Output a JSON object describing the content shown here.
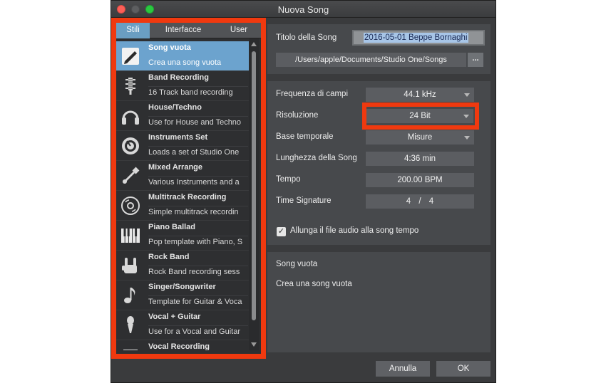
{
  "window": {
    "title": "Nuova Song"
  },
  "tabs": [
    {
      "label": "Stili",
      "active": true
    },
    {
      "label": "Interfacce",
      "active": false
    },
    {
      "label": "User",
      "active": false
    }
  ],
  "styles": [
    {
      "name": "Song vuota",
      "desc": "Crea una song vuota",
      "icon": "blank-document-icon",
      "selected": true
    },
    {
      "name": "Band Recording",
      "desc": "16 Track band recording",
      "icon": "microphone-grille-icon"
    },
    {
      "name": "House/Techno",
      "desc": "Use for House and Techno",
      "icon": "headphones-icon"
    },
    {
      "name": "Instruments Set",
      "desc": "Loads a set of  Studio One",
      "icon": "knob-icon"
    },
    {
      "name": "Mixed Arrange",
      "desc": "Various Instruments and a",
      "icon": "guitar-neck-icon"
    },
    {
      "name": "Multitrack Recording",
      "desc": "Simple multitrack recordin",
      "icon": "disc-icon"
    },
    {
      "name": "Piano Ballad",
      "desc": "Pop template with Piano, S",
      "icon": "piano-keys-icon"
    },
    {
      "name": "Rock Band",
      "desc": "Rock Band recording sess",
      "icon": "rock-hand-icon"
    },
    {
      "name": "Singer/Songwriter",
      "desc": "Template for Guitar & Voca",
      "icon": "music-note-icon"
    },
    {
      "name": "Vocal + Guitar",
      "desc": "Use for a Vocal and Guitar",
      "icon": "vocal-mic-icon"
    },
    {
      "name": "Vocal Recording",
      "desc": "",
      "icon": "vocal-recording-icon"
    }
  ],
  "song": {
    "title_label": "Titolo della Song",
    "title_value": "2016-05-01 Beppe Bornaghi",
    "path": "/Users/apple/Documents/Studio One/Songs",
    "browse_label": "..."
  },
  "settings": {
    "sample_rate_label": "Frequenza di campi",
    "sample_rate": "44.1 kHz",
    "resolution_label": "Risoluzione",
    "resolution": "24 Bit",
    "timebase_label": "Base temporale",
    "timebase": "Misure",
    "length_label": "Lunghezza della Song",
    "length": "4:36 min",
    "tempo_label": "Tempo",
    "tempo": "200.00 BPM",
    "time_sig_label": "Time Signature",
    "time_sig_num": "4",
    "time_sig_sep": "/",
    "time_sig_den": "4",
    "stretch_label": "Allunga il file audio alla song tempo",
    "stretch_checked": true,
    "check_mark": "✓"
  },
  "description": {
    "title": "Song vuota",
    "text": "Crea una song vuota"
  },
  "footer": {
    "cancel_label": "Annulla",
    "ok_label": "OK"
  },
  "colors": {
    "highlight": "#f0390f",
    "selection": "#6ca3ce",
    "panel": "#47494c"
  }
}
